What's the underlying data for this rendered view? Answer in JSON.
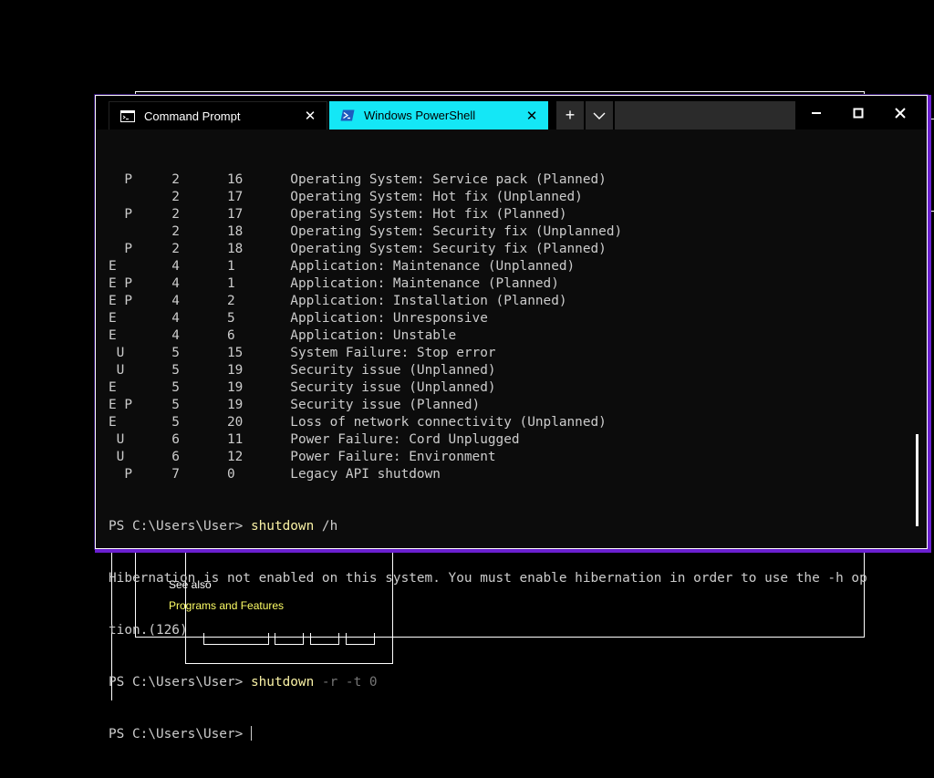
{
  "background": {
    "see_also": "See also",
    "programs_link": "Programs and Features"
  },
  "tabs": [
    {
      "label": "Command Prompt",
      "icon": "cmd-icon",
      "active": false
    },
    {
      "label": "Windows PowerShell",
      "icon": "powershell-icon",
      "active": true
    }
  ],
  "tab_controls": {
    "new_tab": "+",
    "dropdown": "chevron-down-icon"
  },
  "window_controls": {
    "minimize": "minimize-icon",
    "maximize": "maximize-icon",
    "close": "close-icon"
  },
  "console": {
    "reason_rows": [
      {
        "flags": "  P   ",
        "major": "  2",
        "minor": "16",
        "title": "Operating System: Service pack (Planned)"
      },
      {
        "flags": "      ",
        "major": "  2",
        "minor": "17",
        "title": "Operating System: Hot fix (Unplanned)"
      },
      {
        "flags": "  P   ",
        "major": "  2",
        "minor": "17",
        "title": "Operating System: Hot fix (Planned)"
      },
      {
        "flags": "      ",
        "major": "  2",
        "minor": "18",
        "title": "Operating System: Security fix (Unplanned)"
      },
      {
        "flags": "  P   ",
        "major": "  2",
        "minor": "18",
        "title": "Operating System: Security fix (Planned)"
      },
      {
        "flags": "E     ",
        "major": "  4",
        "minor": "1 ",
        "title": "Application: Maintenance (Unplanned)"
      },
      {
        "flags": "E P   ",
        "major": "  4",
        "minor": "1 ",
        "title": "Application: Maintenance (Planned)"
      },
      {
        "flags": "E P   ",
        "major": "  4",
        "minor": "2 ",
        "title": "Application: Installation (Planned)"
      },
      {
        "flags": "E     ",
        "major": "  4",
        "minor": "5 ",
        "title": "Application: Unresponsive"
      },
      {
        "flags": "E     ",
        "major": "  4",
        "minor": "6 ",
        "title": "Application: Unstable"
      },
      {
        "flags": " U    ",
        "major": "  5",
        "minor": "15",
        "title": "System Failure: Stop error"
      },
      {
        "flags": " U    ",
        "major": "  5",
        "minor": "19",
        "title": "Security issue (Unplanned)"
      },
      {
        "flags": "E     ",
        "major": "  5",
        "minor": "19",
        "title": "Security issue (Unplanned)"
      },
      {
        "flags": "E P   ",
        "major": "  5",
        "minor": "19",
        "title": "Security issue (Planned)"
      },
      {
        "flags": "E     ",
        "major": "  5",
        "minor": "20",
        "title": "Loss of network connectivity (Unplanned)"
      },
      {
        "flags": " U    ",
        "major": "  6",
        "minor": "11",
        "title": "Power Failure: Cord Unplugged"
      },
      {
        "flags": " U    ",
        "major": "  6",
        "minor": "12",
        "title": "Power Failure: Environment"
      },
      {
        "flags": "  P   ",
        "major": "  7",
        "minor": "0 ",
        "title": "Legacy API shutdown"
      }
    ],
    "prompt": "PS C:\\Users\\User> ",
    "command1": {
      "cmd": "shutdown",
      "args": " /h"
    },
    "error_line1": "Hibernation is not enabled on this system. You must enable hibernation in order to use the -h op",
    "error_line2": "tion.(126)",
    "command2": {
      "cmd": "shutdown",
      "args": " -r -t 0"
    }
  },
  "colors": {
    "active_tab": "#14e7f6",
    "command": "#f9f1a5",
    "argument": "#767676",
    "text": "#cccccc",
    "link": "#ffff66",
    "window_accent": "#6a1fd0"
  }
}
